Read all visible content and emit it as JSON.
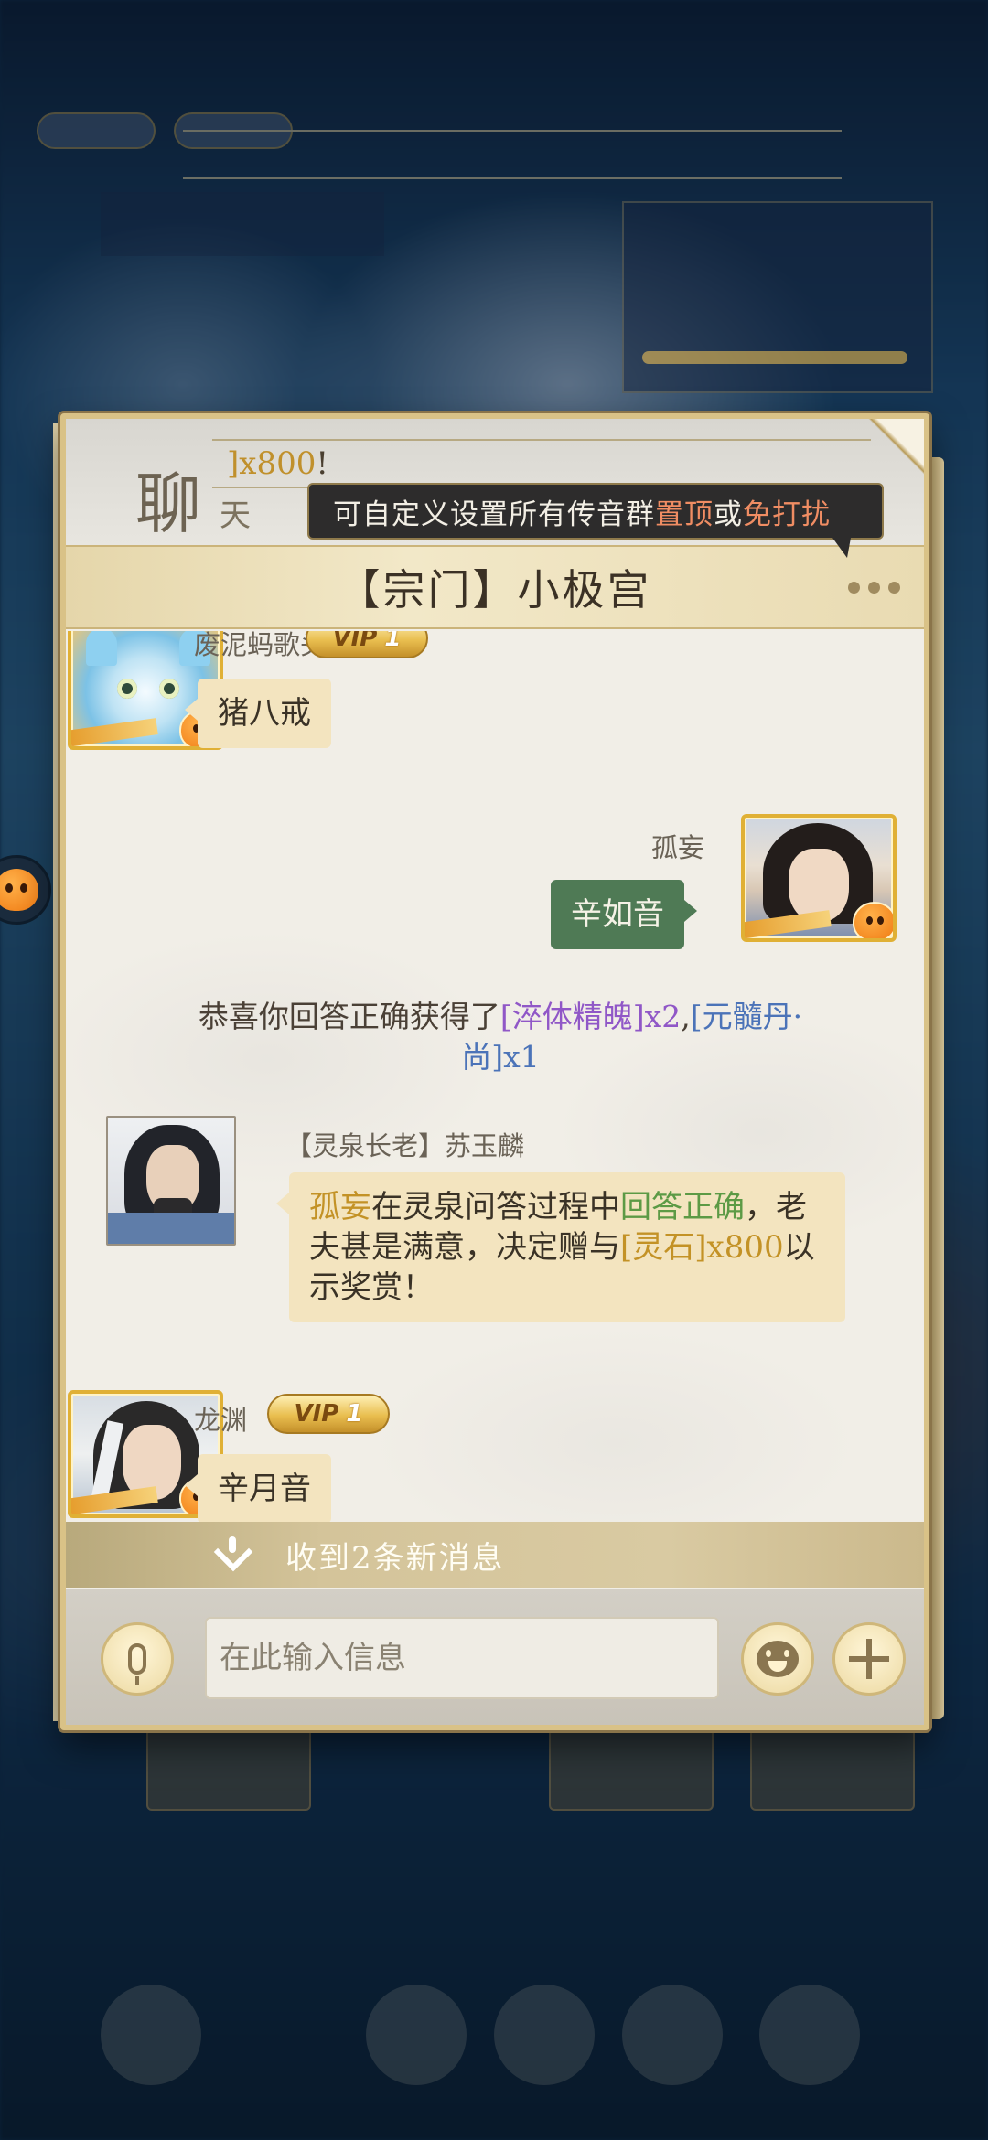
{
  "ticker": {
    "lead_fragment": "]",
    "amount": "x800",
    "tail": "!"
  },
  "panel": {
    "logo_big": "聊",
    "logo_small": "天",
    "tooltip": {
      "part1": "可自定义设置所有传音群",
      "highlight1": "置顶",
      "part2": "或",
      "highlight2": "免打扰"
    },
    "channel_title": "【宗门】小极宫"
  },
  "messages": [
    {
      "sender": "废泥蚂歌头",
      "vip": "VIP",
      "vip_level": "1",
      "text": "猪八戒",
      "side": "left"
    },
    {
      "sender": "孤妄",
      "text": "辛如音",
      "side": "right"
    },
    {
      "system": {
        "prefix": "恭喜你回答正确获得了",
        "item1": "[淬体精魄]x2",
        "sep": ",",
        "item2a": "[元髓丹·",
        "item2b": "尚]x1"
      }
    },
    {
      "sender": "【灵泉长老】苏玉麟",
      "reward": {
        "name": "孤妄",
        "t1": "在灵泉问答过程中",
        "correct": "回答正确",
        "t2": "，老夫甚是满意，决定赠与",
        "item": "[灵石]",
        "amount": "x800",
        "t3": "以示奖赏！"
      }
    },
    {
      "sender": "龙渊",
      "vip": "VIP",
      "vip_level": "1",
      "text": "辛月音",
      "side": "left"
    }
  ],
  "new_messages_banner": "收到2条新消息",
  "input": {
    "placeholder": "在此输入信息"
  },
  "colors": {
    "accent_gold": "#c39226",
    "bubble_green": "#4f7a55",
    "item_purple": "#9057c7",
    "item_blue": "#4b73b8"
  },
  "icons": [
    "mic-icon",
    "emoji-icon",
    "plus-icon",
    "more-icon",
    "chevron-up-icon",
    "mascot-icon"
  ]
}
